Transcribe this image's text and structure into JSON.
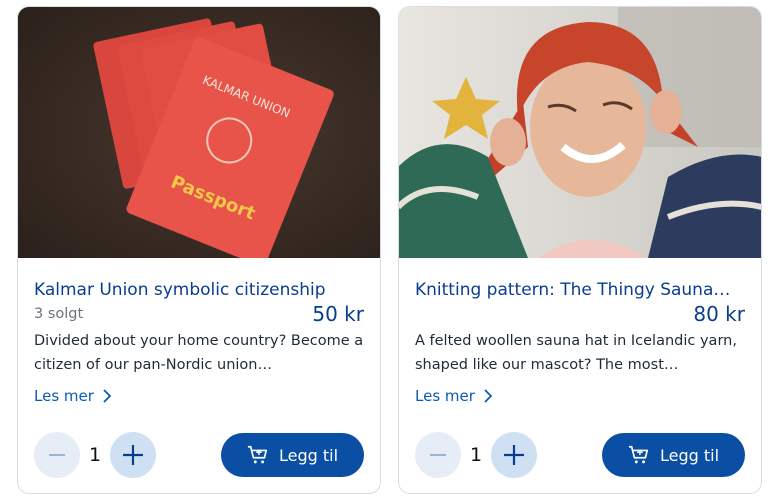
{
  "products": [
    {
      "title": "Kalmar Union symbolic citizenship",
      "sold": "3 solgt",
      "price": "50 kr",
      "description": "Divided about your home country? Become a citizen of our pan-Nordic union…",
      "read_more": "Les mer",
      "quantity": "1",
      "add_label": "Legg til",
      "image": "passport-photo",
      "passport_text": [
        "KALMAR UNION",
        "Passport"
      ]
    },
    {
      "title": "Knitting pattern: The Thingy Sauna…",
      "sold": "",
      "price": "80 kr",
      "description": "A felted woollen sauna hat in Icelandic yarn, shaped like our mascot? The most…",
      "read_more": "Les mer",
      "quantity": "1",
      "add_label": "Legg til",
      "image": "knit-hat-photo"
    }
  ],
  "colors": {
    "brand": "#0a4fa3",
    "link": "#0a5bb5",
    "title": "#0a3d8f",
    "minus_bg": "#e6edf6",
    "plus_bg": "#cfe0f3"
  },
  "icons": {
    "minus": "minus-icon",
    "plus": "plus-icon",
    "cart": "cart-plus-icon",
    "chevron": "chevron-right-icon"
  }
}
